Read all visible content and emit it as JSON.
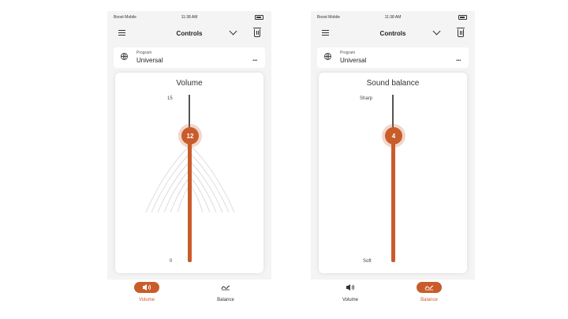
{
  "colors": {
    "accent": "#c95c2b",
    "track": "#555555",
    "background": "#f4f4f4"
  },
  "screens": [
    {
      "statusbar": {
        "carrier": "Boost Mobile",
        "time": "11:38 AM"
      },
      "nav": {
        "title": "Controls",
        "menu_icon": "hamburger-icon",
        "chevron_icon": "chevron-down-icon",
        "trash_icon": "trash-icon"
      },
      "program": {
        "label": "Program",
        "value": "Universal",
        "more": "..."
      },
      "control": {
        "title": "Volume",
        "max_label": "15",
        "min_label": "0",
        "value": "12",
        "level_fraction": 0.8
      },
      "tabs": [
        {
          "label": "Volume",
          "icon": "speaker-icon",
          "active": true
        },
        {
          "label": "Balance",
          "icon": "balance-icon",
          "active": false
        }
      ]
    },
    {
      "statusbar": {
        "carrier": "Boost Mobile",
        "time": "11:38 AM"
      },
      "nav": {
        "title": "Controls",
        "menu_icon": "hamburger-icon",
        "chevron_icon": "chevron-down-icon",
        "trash_icon": "trash-icon"
      },
      "program": {
        "label": "Program",
        "value": "Universal",
        "more": "..."
      },
      "control": {
        "title": "Sound balance",
        "max_label": "Sharp",
        "min_label": "Soft",
        "value": "4",
        "level_fraction": 0.78
      },
      "tabs": [
        {
          "label": "Volume",
          "icon": "speaker-icon",
          "active": false
        },
        {
          "label": "Balance",
          "icon": "balance-icon",
          "active": true
        }
      ]
    }
  ]
}
